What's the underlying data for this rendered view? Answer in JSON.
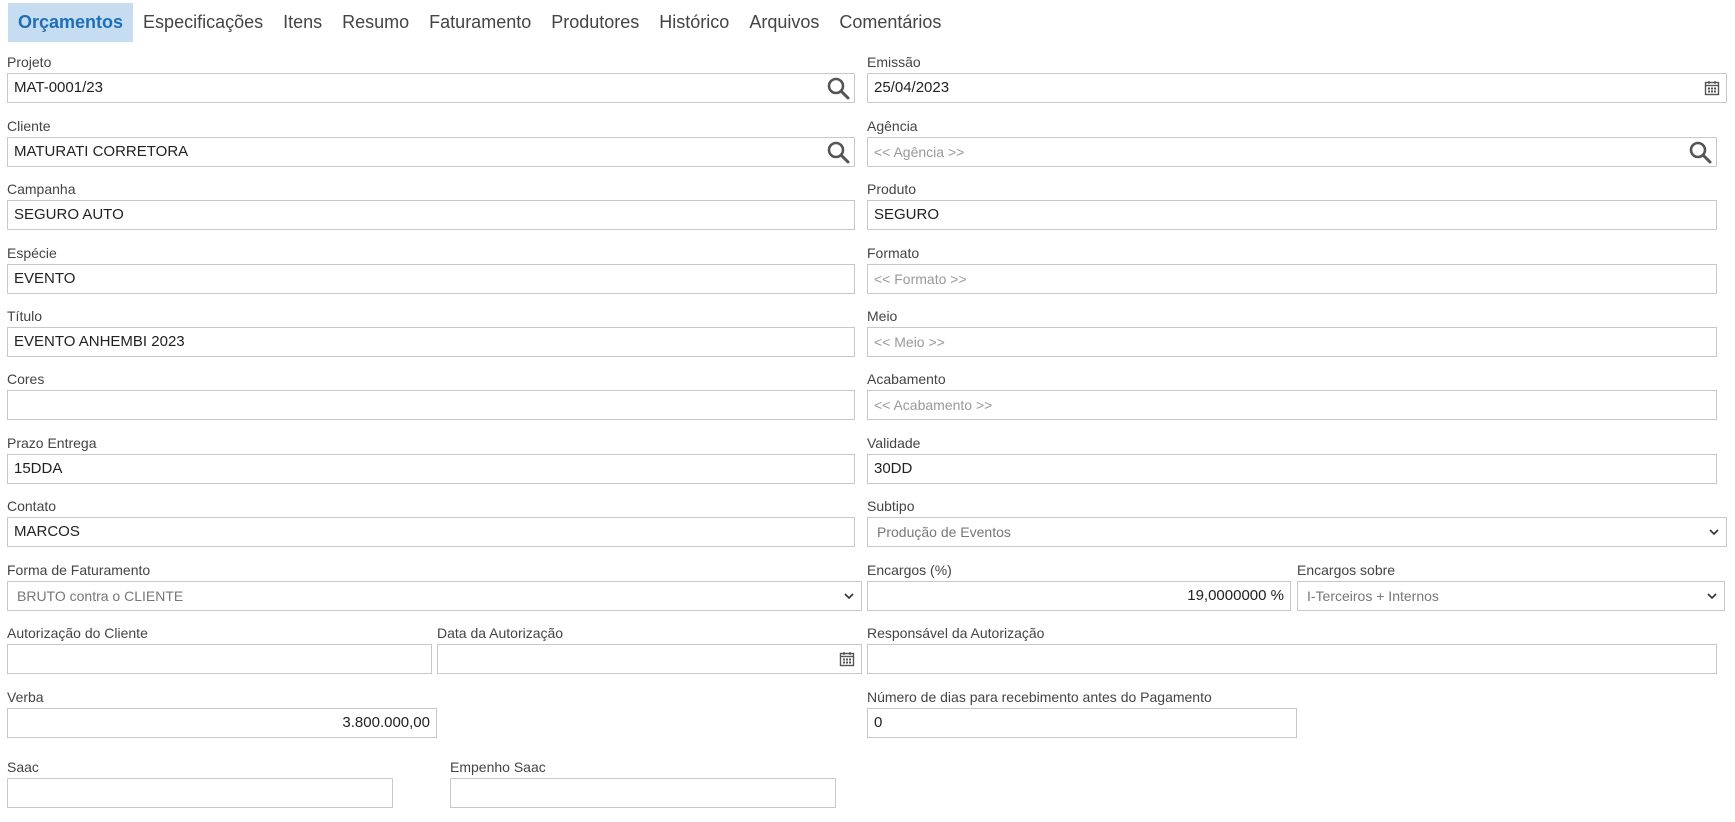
{
  "tabs": [
    "Orçamentos",
    "Especificações",
    "Itens",
    "Resumo",
    "Faturamento",
    "Produtores",
    "Histórico",
    "Arquivos",
    "Comentários"
  ],
  "fields": {
    "projeto": {
      "label": "Projeto",
      "value": "MAT-0001/23"
    },
    "emissao": {
      "label": "Emissão",
      "value": "25/04/2023"
    },
    "cliente": {
      "label": "Cliente",
      "value": "MATURATI CORRETORA"
    },
    "agencia": {
      "label": "Agência",
      "placeholder": "<< Agência >>"
    },
    "campanha": {
      "label": "Campanha",
      "value": "SEGURO AUTO"
    },
    "produto": {
      "label": "Produto",
      "value": "SEGURO"
    },
    "especie": {
      "label": "Espécie",
      "value": "EVENTO"
    },
    "formato": {
      "label": "Formato",
      "placeholder": "<< Formato >>"
    },
    "titulo": {
      "label": "Título",
      "value": "EVENTO ANHEMBI 2023"
    },
    "meio": {
      "label": "Meio",
      "placeholder": "<< Meio >>"
    },
    "cores": {
      "label": "Cores",
      "value": ""
    },
    "acabamento": {
      "label": "Acabamento",
      "placeholder": "<< Acabamento >>"
    },
    "prazo_entrega": {
      "label": "Prazo Entrega",
      "value": "15DDA"
    },
    "validade": {
      "label": "Validade",
      "value": "30DD"
    },
    "contato": {
      "label": "Contato",
      "value": "MARCOS"
    },
    "subtipo": {
      "label": "Subtipo",
      "value": "Produção de Eventos"
    },
    "forma_faturamento": {
      "label": "Forma de Faturamento",
      "value": "BRUTO contra o CLIENTE"
    },
    "encargos_pct": {
      "label": "Encargos (%)",
      "value": "19,0000000 %"
    },
    "encargos_sobre": {
      "label": "Encargos sobre",
      "value": "I-Terceiros + Internos"
    },
    "autorizacao_cliente": {
      "label": "Autorização do Cliente",
      "value": ""
    },
    "data_autorizacao": {
      "label": "Data da Autorização",
      "value": ""
    },
    "responsavel_autorizacao": {
      "label": "Responsável da Autorização",
      "value": ""
    },
    "verba": {
      "label": "Verba",
      "value": "3.800.000,00"
    },
    "num_dias": {
      "label": "Número de dias para recebimento antes do Pagamento",
      "value": "0"
    },
    "saac": {
      "label": "Saac",
      "value": ""
    },
    "empenho_saac": {
      "label": "Empenho Saac",
      "value": ""
    }
  },
  "icons": {
    "lookup": "search-icon",
    "date": "calendar-icon",
    "select": "chevron-down-icon"
  },
  "colors": {
    "tab_active_bg": "#c6dcf0",
    "tab_active_text": "#1f6fb8",
    "border": "#c8c8c8"
  }
}
